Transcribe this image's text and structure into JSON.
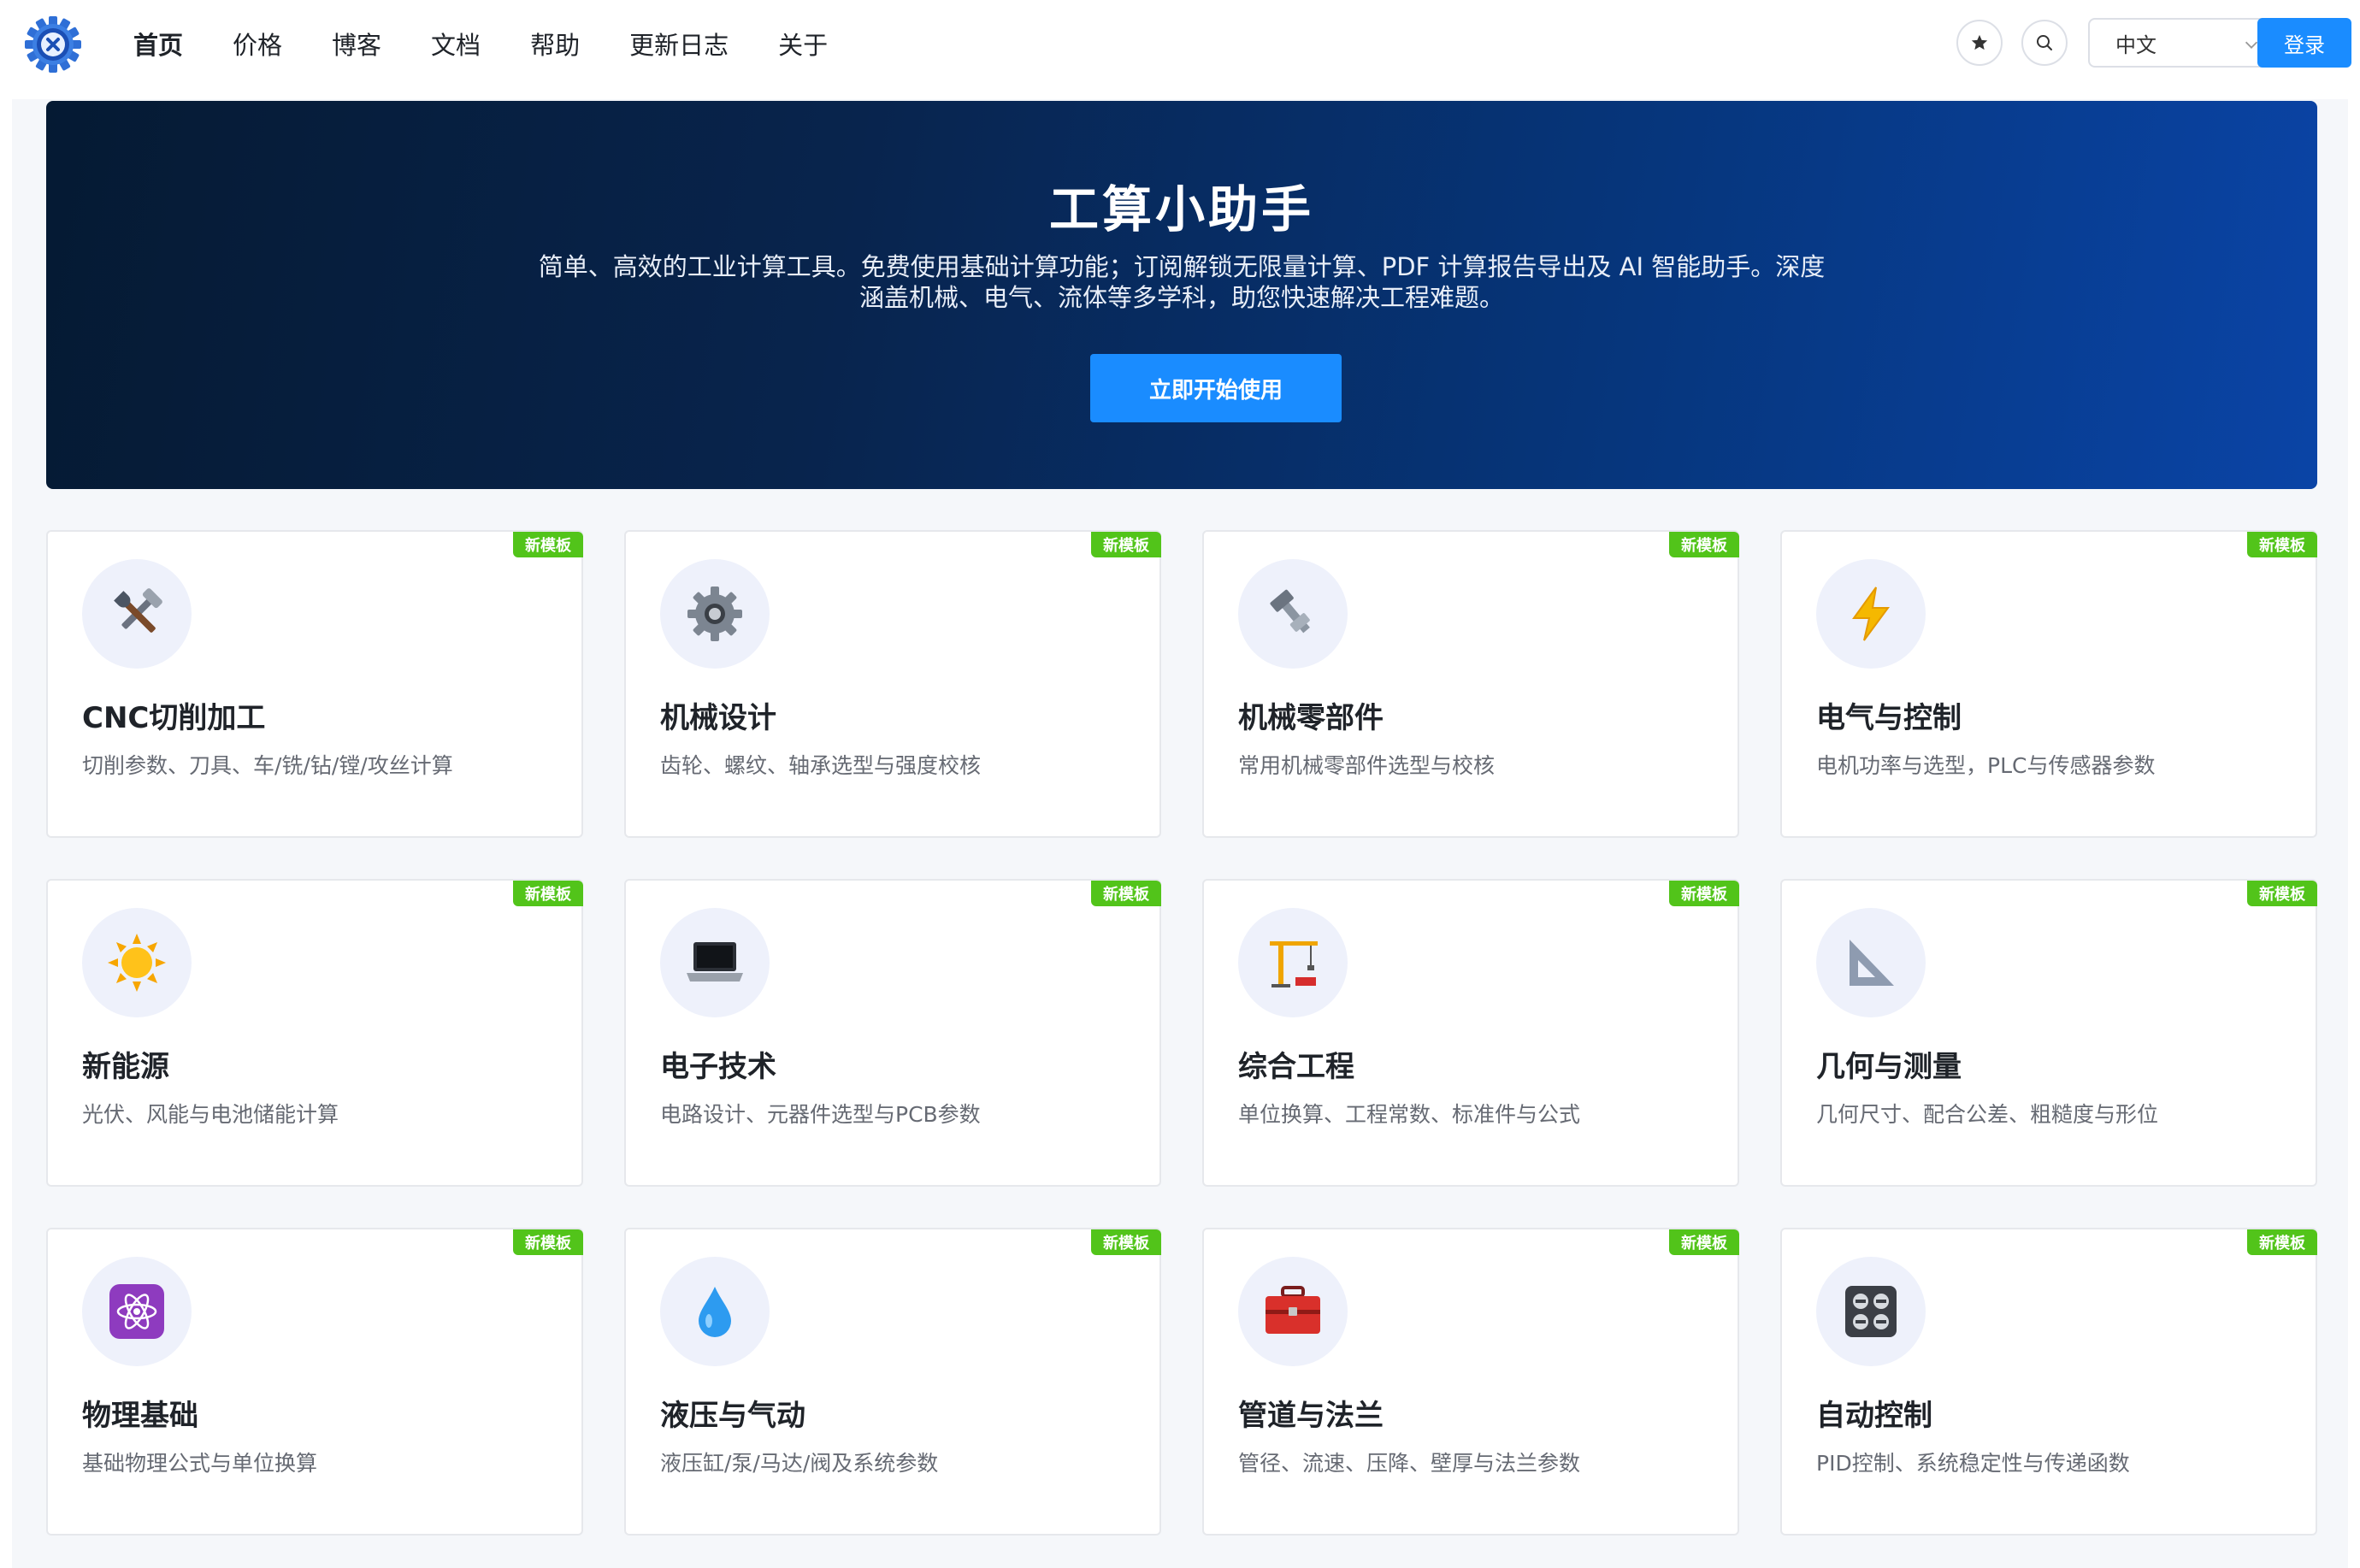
{
  "header": {
    "nav": [
      {
        "label": "首页",
        "active": true
      },
      {
        "label": "价格",
        "active": false
      },
      {
        "label": "博客",
        "active": false
      },
      {
        "label": "文档",
        "active": false
      },
      {
        "label": "帮助",
        "active": false
      },
      {
        "label": "更新日志",
        "active": false
      },
      {
        "label": "关于",
        "active": false
      }
    ],
    "language": "中文",
    "login_label": "登录"
  },
  "hero": {
    "title": "工算小助手",
    "description_line1": "简单、高效的工业计算工具。免费使用基础计算功能；订阅解锁无限量计算、PDF 计算报告导出及 AI 智能助手。深度",
    "description_line2": "涵盖机械、电气、流体等多学科，助您快速解决工程难题。",
    "cta_label": "立即开始使用"
  },
  "cards": [
    {
      "badge": "新模板",
      "icon": "tools-icon",
      "title": "CNC切削加工",
      "desc": "切削参数、刀具、车/铣/钻/镗/攻丝计算"
    },
    {
      "badge": "新模板",
      "icon": "gear-icon",
      "title": "机械设计",
      "desc": "齿轮、螺纹、轴承选型与强度校核"
    },
    {
      "badge": "新模板",
      "icon": "bolt-nut-icon",
      "title": "机械零部件",
      "desc": "常用机械零部件选型与校核"
    },
    {
      "badge": "新模板",
      "icon": "lightning-icon",
      "title": "电气与控制",
      "desc": "电机功率与选型，PLC与传感器参数"
    },
    {
      "badge": "新模板",
      "icon": "sun-icon",
      "title": "新能源",
      "desc": "光伏、风能与电池储能计算"
    },
    {
      "badge": "新模板",
      "icon": "laptop-icon",
      "title": "电子技术",
      "desc": "电路设计、元器件选型与PCB参数"
    },
    {
      "badge": "新模板",
      "icon": "crane-icon",
      "title": "综合工程",
      "desc": "单位换算、工程常数、标准件与公式"
    },
    {
      "badge": "新模板",
      "icon": "triangle-ruler-icon",
      "title": "几何与测量",
      "desc": "几何尺寸、配合公差、粗糙度与形位"
    },
    {
      "badge": "新模板",
      "icon": "atom-icon",
      "title": "物理基础",
      "desc": "基础物理公式与单位换算"
    },
    {
      "badge": "新模板",
      "icon": "droplet-icon",
      "title": "液压与气动",
      "desc": "液压缸/泵/马达/阀及系统参数"
    },
    {
      "badge": "新模板",
      "icon": "toolbox-icon",
      "title": "管道与法兰",
      "desc": "管径、流速、压降、壁厚与法兰参数"
    },
    {
      "badge": "新模板",
      "icon": "control-panel-icon",
      "title": "自动控制",
      "desc": "PID控制、系统稳定性与传递函数"
    }
  ]
}
